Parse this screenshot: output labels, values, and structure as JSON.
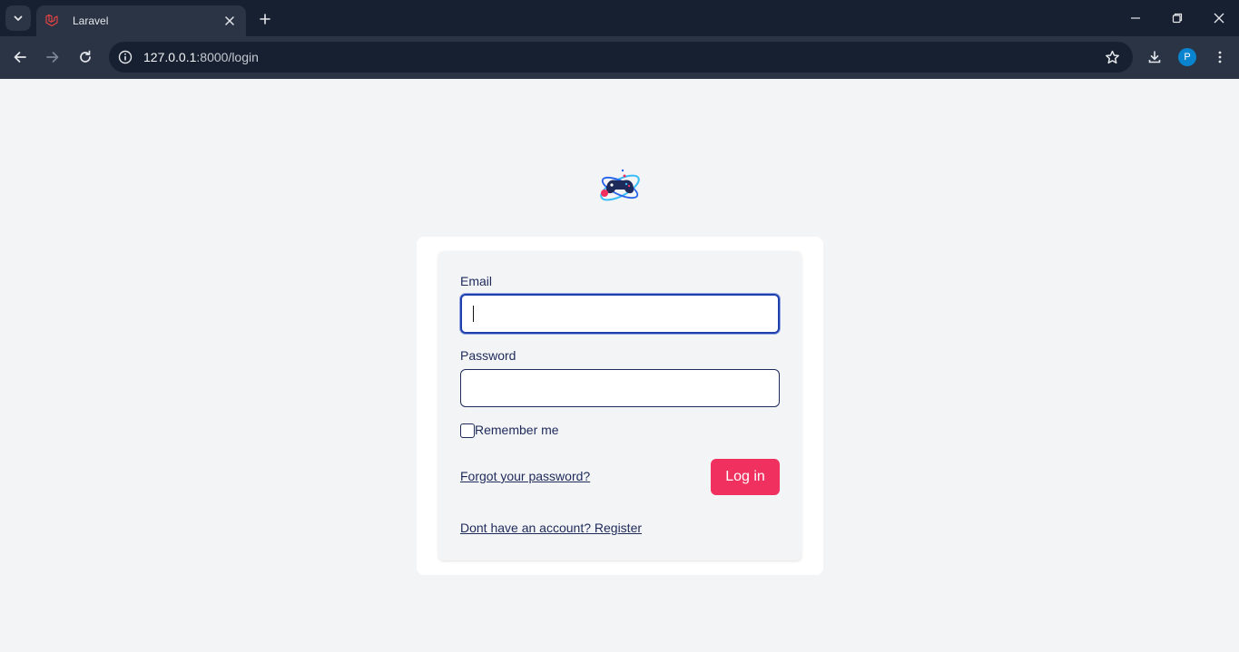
{
  "browser": {
    "tab_title": "Laravel",
    "url_host": "127.0.0.1",
    "url_path": ":8000/login",
    "profile_initial": "P"
  },
  "page": {
    "email_label": "Email",
    "email_value": "",
    "password_label": "Password",
    "password_value": "",
    "remember_label": "Remember me",
    "remember_checked": false,
    "forgot_link": "Forgot your password?",
    "login_button": "Log in",
    "register_link": "Dont have an account? Register"
  },
  "colors": {
    "accent": "#f0305f",
    "navy": "#1e2a5a",
    "focus": "#1e40af",
    "page_bg": "#f3f4f6"
  },
  "icons": [
    "chevron-down-icon",
    "laravel-icon",
    "close-icon",
    "plus-icon",
    "minimize-icon",
    "restore-icon",
    "back-icon",
    "forward-icon",
    "reload-icon",
    "info-icon",
    "star-icon",
    "download-icon",
    "menu-icon",
    "game-controller-logo"
  ]
}
